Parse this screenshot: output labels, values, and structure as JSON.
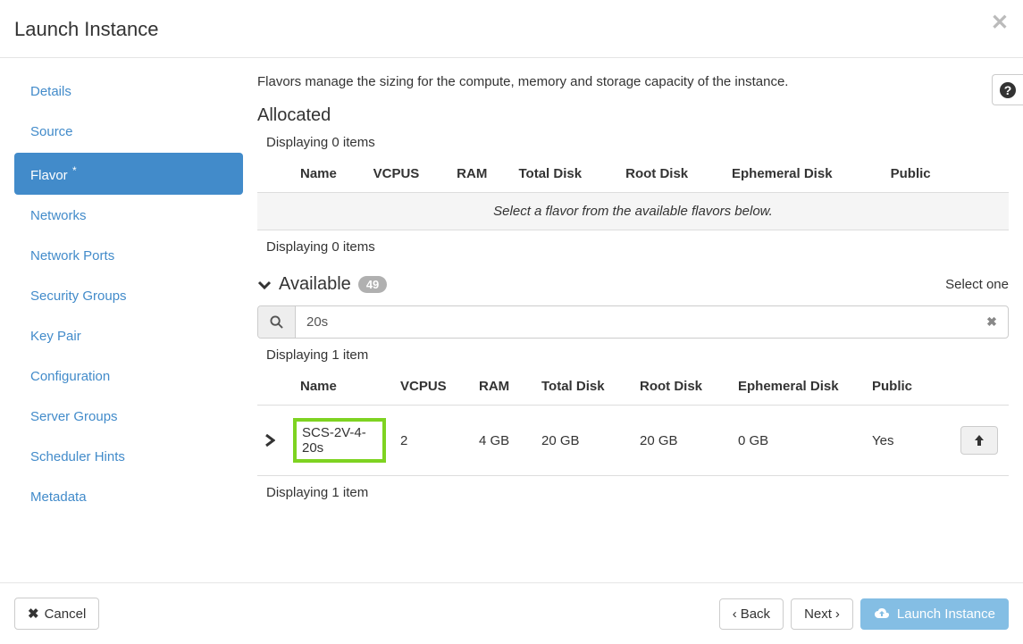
{
  "header": {
    "title": "Launch Instance"
  },
  "sidebar": {
    "items": [
      {
        "label": "Details",
        "active": false
      },
      {
        "label": "Source",
        "active": false
      },
      {
        "label": "Flavor",
        "active": true,
        "required": true
      },
      {
        "label": "Networks",
        "active": false
      },
      {
        "label": "Network Ports",
        "active": false
      },
      {
        "label": "Security Groups",
        "active": false
      },
      {
        "label": "Key Pair",
        "active": false
      },
      {
        "label": "Configuration",
        "active": false
      },
      {
        "label": "Server Groups",
        "active": false
      },
      {
        "label": "Scheduler Hints",
        "active": false
      },
      {
        "label": "Metadata",
        "active": false
      }
    ]
  },
  "content": {
    "description": "Flavors manage the sizing for the compute, memory and storage capacity of the instance.",
    "allocated": {
      "title": "Allocated",
      "displaying_top": "Displaying 0 items",
      "empty_text": "Select a flavor from the available flavors below.",
      "displaying_bottom": "Displaying 0 items",
      "columns": [
        "Name",
        "VCPUS",
        "RAM",
        "Total Disk",
        "Root Disk",
        "Ephemeral Disk",
        "Public"
      ]
    },
    "available": {
      "title": "Available",
      "count": "49",
      "select_label": "Select one",
      "search_value": "20s",
      "displaying_top": "Displaying 1 item",
      "displaying_bottom": "Displaying 1 item",
      "columns": [
        "Name",
        "VCPUS",
        "RAM",
        "Total Disk",
        "Root Disk",
        "Ephemeral Disk",
        "Public"
      ],
      "rows": [
        {
          "name": "SCS-2V-4-20s",
          "vcpus": "2",
          "ram": "4 GB",
          "total_disk": "20 GB",
          "root_disk": "20 GB",
          "ephemeral_disk": "0 GB",
          "public": "Yes"
        }
      ]
    }
  },
  "footer": {
    "cancel": "Cancel",
    "back": "Back",
    "next": "Next",
    "launch": "Launch Instance"
  }
}
